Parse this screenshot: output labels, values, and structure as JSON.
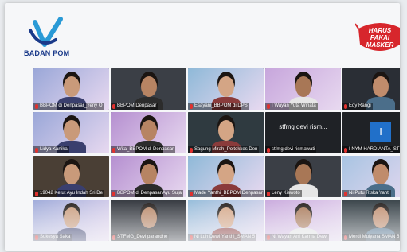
{
  "logos": {
    "badan_pom": "BADAN POM",
    "mask_line1": "HARUS",
    "mask_line2": "PAKAI",
    "mask_line3": "MASKER"
  },
  "participants": [
    {
      "name": "BBPOM di Denpasar_Yeny O"
    },
    {
      "name": "BBPOM Denpasar"
    },
    {
      "name": "Esayani_BBPOM di DPS"
    },
    {
      "name": "I Wayan Yuta Winata"
    },
    {
      "name": "Edy Rangi"
    },
    {
      "name": "Lidya Kartika"
    },
    {
      "name": "Wita_BBPOM di Denpasar"
    },
    {
      "name": "Sagung Mirah_Poltekkes Den"
    },
    {
      "name": "stfmg devi rismawati",
      "overlay": "stfmg devi rism..."
    },
    {
      "name": "I NYM HARDIANTA_STFMG",
      "initial": "I"
    },
    {
      "name": "19042 Ketut Ayu Indah Sri De"
    },
    {
      "name": "BBPOM di Denpasar Ayu Suja"
    },
    {
      "name": "Made Yanthi_BBPOM Denpasar"
    },
    {
      "name": "Leny Kiswoto"
    },
    {
      "name": "Ni Putu Riska Yanti"
    },
    {
      "name": "Sukesya Saka"
    },
    {
      "name": "STFMG_Devi parandhe"
    },
    {
      "name": "Ni Luh Dewi Yanthi_SMAN 5"
    },
    {
      "name": "Ni Wayan Ani Karma Dewi"
    },
    {
      "name": "Merdi Mulyana SMAN 5 Den"
    }
  ]
}
